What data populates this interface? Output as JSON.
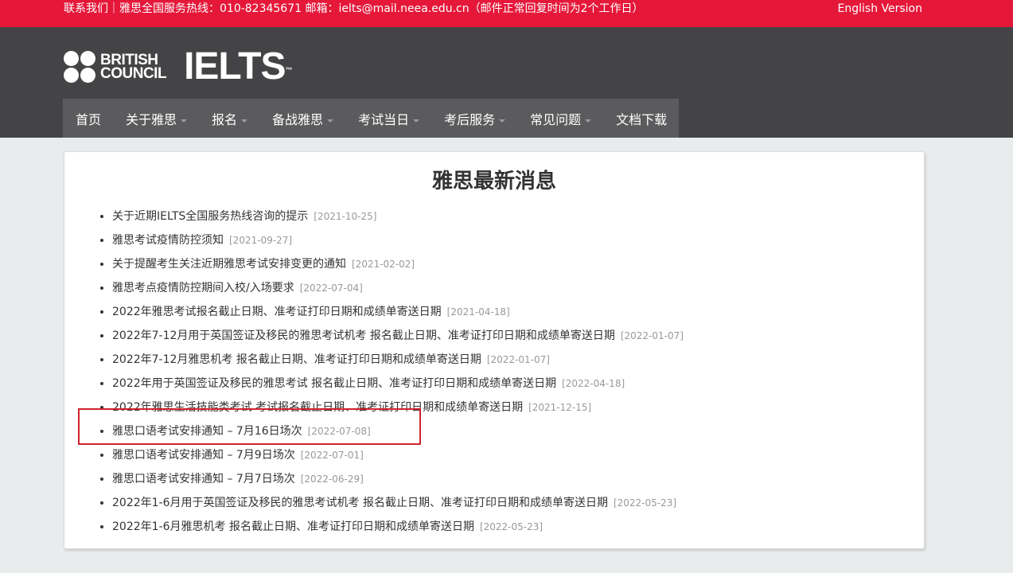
{
  "topbar": {
    "contact": "联系我们｜雅思全国服务热线：010-82345671   邮箱：ielts@mail.neea.edu.cn（邮件正常回复时间为2个工作日）",
    "english": "English Version"
  },
  "logo": {
    "british": "BRITISH",
    "council": "COUNCIL",
    "ielts": "IELTS",
    "tm": "™"
  },
  "nav": [
    {
      "label": "首页",
      "dropdown": false
    },
    {
      "label": "关于雅思",
      "dropdown": true
    },
    {
      "label": "报名",
      "dropdown": true
    },
    {
      "label": "备战雅思",
      "dropdown": true
    },
    {
      "label": "考试当日",
      "dropdown": true
    },
    {
      "label": "考后服务",
      "dropdown": true
    },
    {
      "label": "常见问题",
      "dropdown": true
    },
    {
      "label": "文档下载",
      "dropdown": false
    }
  ],
  "main": {
    "title": "雅思最新消息",
    "news": [
      {
        "title": "关于近期IELTS全国服务热线咨询的提示",
        "date": "[2021-10-25]"
      },
      {
        "title": "雅思考试疫情防控须知",
        "date": "[2021-09-27]"
      },
      {
        "title": "关于提醒考生关注近期雅思考试安排变更的通知",
        "date": "[2021-02-02]"
      },
      {
        "title": "雅思考点疫情防控期间入校/入场要求",
        "date": "[2022-07-04]"
      },
      {
        "title": "2022年雅思考试报名截止日期、准考证打印日期和成绩单寄送日期",
        "date": "[2021-04-18]"
      },
      {
        "title": "2022年7-12月用于英国签证及移民的雅思考试机考 报名截止日期、准考证打印日期和成绩单寄送日期",
        "date": "[2022-01-07]"
      },
      {
        "title": "2022年7-12月雅思机考 报名截止日期、准考证打印日期和成绩单寄送日期",
        "date": "[2022-01-07]"
      },
      {
        "title": "2022年用于英国签证及移民的雅思考试 报名截止日期、准考证打印日期和成绩单寄送日期",
        "date": "[2022-04-18]"
      },
      {
        "title": "2022年雅思生活技能类考试 考试报名截止日期、准考证打印日期和成绩单寄送日期",
        "date": "[2021-12-15]"
      },
      {
        "title": "雅思口语考试安排通知 – 7月16日场次",
        "date": "[2022-07-08]"
      },
      {
        "title": "雅思口语考试安排通知 – 7月9日场次",
        "date": "[2022-07-01]"
      },
      {
        "title": "雅思口语考试安排通知 – 7月7日场次",
        "date": "[2022-06-29]"
      },
      {
        "title": "2022年1-6月用于英国签证及移民的雅思考试机考 报名截止日期、准考证打印日期和成绩单寄送日期",
        "date": "[2022-05-23]"
      },
      {
        "title": "2022年1-6月雅思机考 报名截止日期、准考证打印日期和成绩单寄送日期",
        "date": "[2022-05-23]"
      }
    ]
  },
  "colors": {
    "topbar": "#e5183a",
    "header": "#444446",
    "nav": "#5b5b5d",
    "highlight": "#d0232b"
  }
}
